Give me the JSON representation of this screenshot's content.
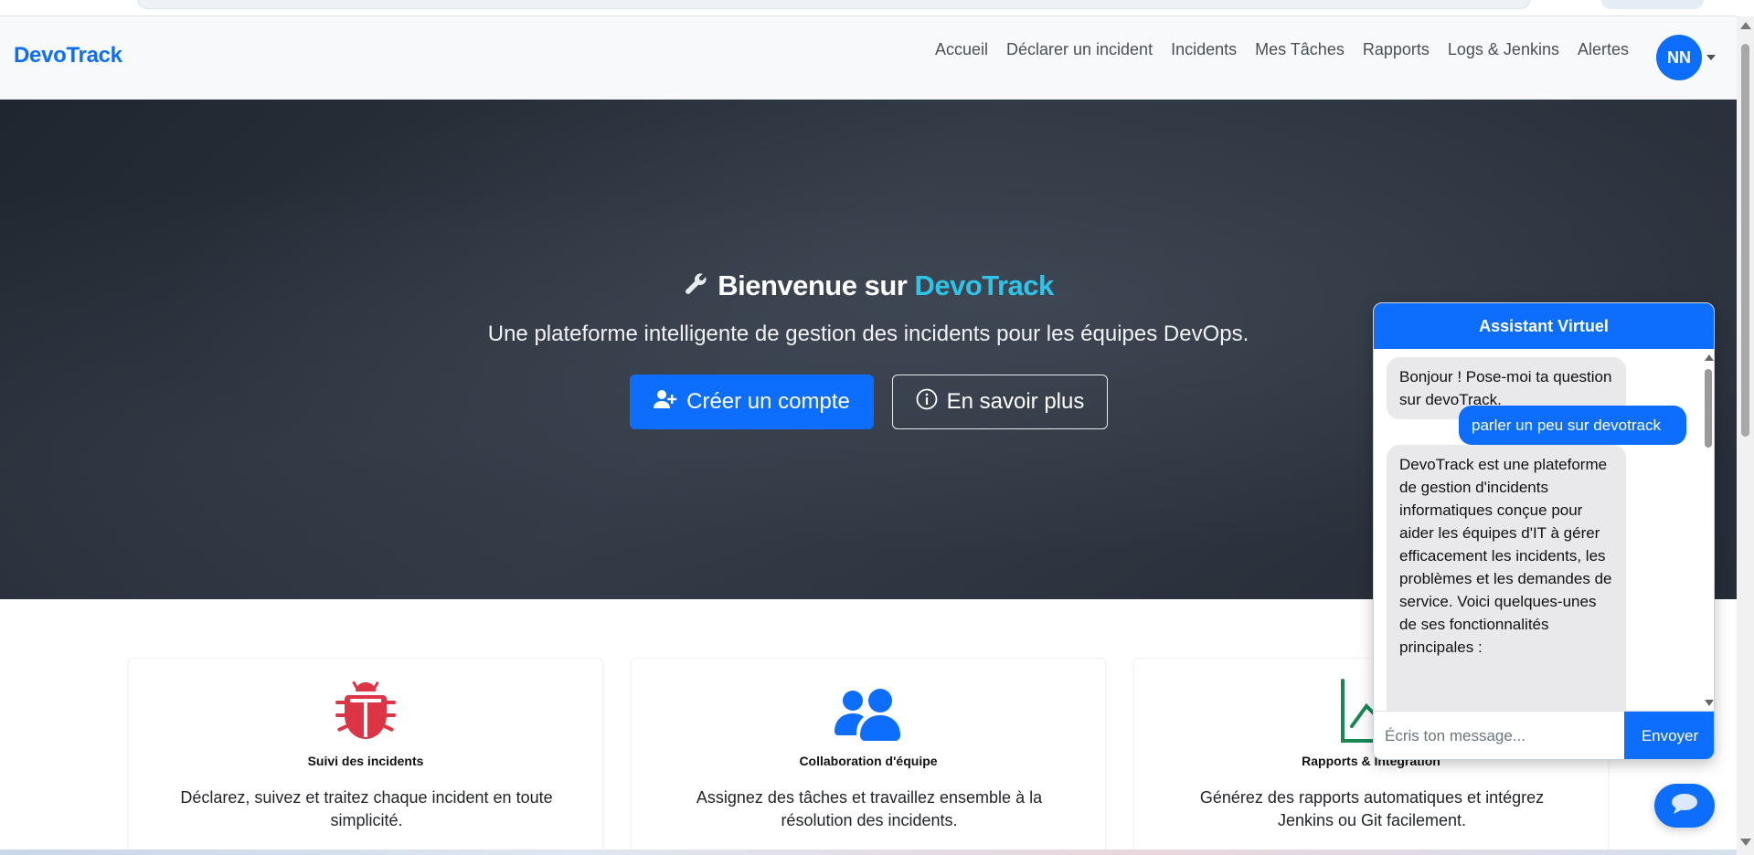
{
  "navbar": {
    "brand": "DevoTrack",
    "links": [
      "Accueil",
      "Déclarer un incident",
      "Incidents",
      "Mes Tâches",
      "Rapports",
      "Logs & Jenkins",
      "Alertes"
    ],
    "avatar_initials": "NN"
  },
  "hero": {
    "title_prefix": "Bienvenue sur",
    "title_accent": "DevoTrack",
    "subtitle": "Une plateforme intelligente de gestion des incidents pour les équipes DevOps.",
    "primary_button": "Créer un compte",
    "secondary_button": "En savoir plus"
  },
  "features": [
    {
      "icon": "bug-icon",
      "title": "Suivi des incidents",
      "description": "Déclarez, suivez et traitez chaque incident en toute simplicité."
    },
    {
      "icon": "users-icon",
      "title": "Collaboration d'équipe",
      "description": "Assignez des tâches et travaillez ensemble à la résolution des incidents."
    },
    {
      "icon": "chart-icon",
      "title": "Rapports & Intégration",
      "description": "Générez des rapports automatiques et intégrez Jenkins ou Git facilement."
    }
  ],
  "chat": {
    "header": "Assistant Virtuel",
    "messages": [
      {
        "from": "bot",
        "text": "Bonjour ! Pose-moi ta question sur devoTrack."
      },
      {
        "from": "user",
        "text": "parler un peu sur devotrack"
      },
      {
        "from": "bot",
        "text": "DevoTrack est une plateforme de gestion d'incidents informatiques conçue pour aider les équipes d'IT à gérer efficacement les incidents, les problèmes et les demandes de service. Voici quelques-unes de ses fonctionnalités principales :"
      }
    ],
    "input_placeholder": "Écris ton message...",
    "send_label": "Envoyer"
  },
  "colors": {
    "primary": "#0d6efd",
    "accent": "#2fc3e8",
    "bug_red": "#dc3545",
    "chart_green": "#198754"
  }
}
